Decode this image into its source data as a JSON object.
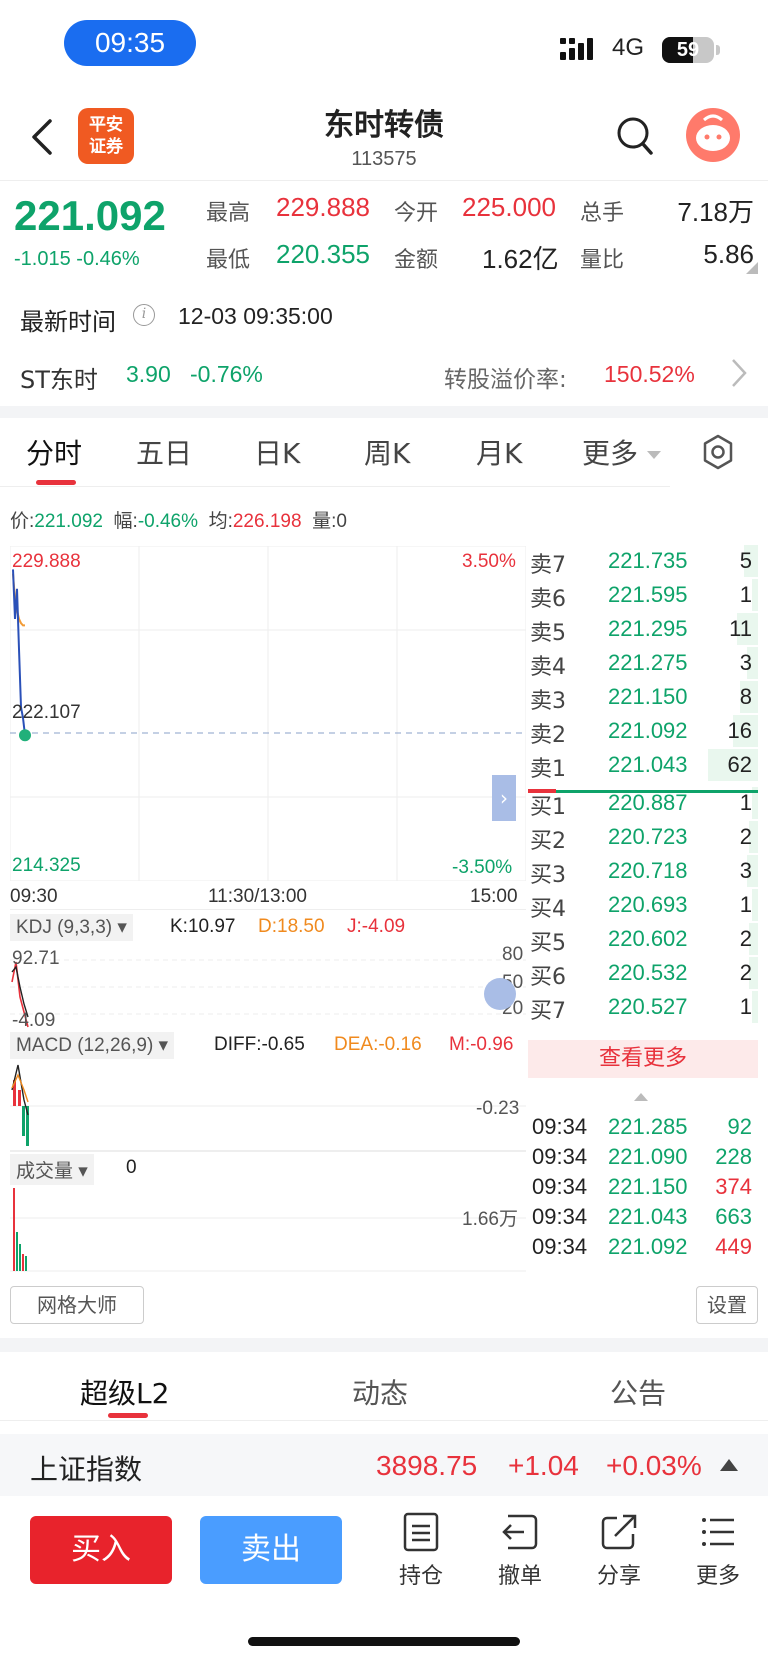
{
  "status_bar": {
    "time": "09:35",
    "network": "4G",
    "battery": "59"
  },
  "header": {
    "title": "东时转债",
    "code": "113575",
    "logo_line1": "平安",
    "logo_line2": "证券"
  },
  "quote": {
    "price": "221.092",
    "change": "-1.015",
    "change_pct": "-0.46%",
    "high_label": "最高",
    "high": "229.888",
    "open_label": "今开",
    "open": "225.000",
    "volume_label": "总手",
    "volume": "7.18万",
    "low_label": "最低",
    "low": "220.355",
    "amount_label": "金额",
    "amount": "1.62亿",
    "ratio_label": "量比",
    "ratio": "5.86",
    "latest_time_label": "最新时间",
    "latest_time": "12-03 09:35:00",
    "stock_name": "ST东时",
    "stock_price": "3.90",
    "stock_change": "-0.76%",
    "premium_label": "转股溢价率:",
    "premium": "150.52%"
  },
  "tabs": [
    "分时",
    "五日",
    "日K",
    "周K",
    "月K",
    "更多"
  ],
  "chart_info": {
    "price_label": "价:",
    "price": "221.092",
    "range_label": "幅:",
    "range": "-0.46%",
    "avg_label": "均:",
    "avg": "226.198",
    "vol_label": "量:",
    "vol": "0"
  },
  "chart_data": {
    "type": "line",
    "y_high": "229.888",
    "y_mid": "222.107",
    "y_low": "214.325",
    "pct_high": "3.50%",
    "pct_low": "-3.50%",
    "x_labels": [
      "09:30",
      "11:30/13:00",
      "15:00"
    ],
    "ylim": [
      214.325,
      229.888
    ],
    "series": [
      {
        "values": [
          228.8,
          226.5,
          227.9,
          225.1,
          222.4,
          221.9,
          221.092
        ]
      },
      {
        "values": [
          228.6,
          227.4,
          226.9,
          226.5,
          226.3,
          226.2,
          226.198
        ]
      }
    ]
  },
  "kdj": {
    "selector": "KDJ (9,3,3)",
    "k": "K:10.97",
    "d": "D:18.50",
    "j": "J:-4.09",
    "top": "92.71",
    "bottom": "-4.09",
    "l80": "80",
    "l50": "50",
    "l20": "20"
  },
  "macd": {
    "selector": "MACD (12,26,9)",
    "diff": "DIFF:-0.65",
    "dea": "DEA:-0.16",
    "m": "M:-0.96",
    "level": "-0.23"
  },
  "volume": {
    "selector": "成交量",
    "value": "0",
    "level": "1.66万"
  },
  "order_book": {
    "asks": [
      {
        "label": "卖7",
        "price": "221.735",
        "qty": "5"
      },
      {
        "label": "卖6",
        "price": "221.595",
        "qty": "1"
      },
      {
        "label": "卖5",
        "price": "221.295",
        "qty": "11"
      },
      {
        "label": "卖4",
        "price": "221.275",
        "qty": "3"
      },
      {
        "label": "卖3",
        "price": "221.150",
        "qty": "8"
      },
      {
        "label": "卖2",
        "price": "221.092",
        "qty": "16"
      },
      {
        "label": "卖1",
        "price": "221.043",
        "qty": "62"
      }
    ],
    "bids": [
      {
        "label": "买1",
        "price": "220.887",
        "qty": "1"
      },
      {
        "label": "买2",
        "price": "220.723",
        "qty": "2"
      },
      {
        "label": "买3",
        "price": "220.718",
        "qty": "3"
      },
      {
        "label": "买4",
        "price": "220.693",
        "qty": "1"
      },
      {
        "label": "买5",
        "price": "220.602",
        "qty": "2"
      },
      {
        "label": "买6",
        "price": "220.532",
        "qty": "2"
      },
      {
        "label": "买7",
        "price": "220.527",
        "qty": "1"
      }
    ],
    "more_label": "查看更多"
  },
  "trades": [
    {
      "time": "09:34",
      "price": "221.285",
      "qty": "92",
      "side": "green"
    },
    {
      "time": "09:34",
      "price": "221.090",
      "qty": "228",
      "side": "green"
    },
    {
      "time": "09:34",
      "price": "221.150",
      "qty": "374",
      "side": "red"
    },
    {
      "time": "09:34",
      "price": "221.043",
      "qty": "663",
      "side": "green"
    },
    {
      "time": "09:34",
      "price": "221.092",
      "qty": "449",
      "side": "red"
    }
  ],
  "tools": {
    "grid": "网格大师",
    "settings": "设置"
  },
  "bottom_tabs": [
    "超级L2",
    "动态",
    "公告"
  ],
  "index": {
    "name": "上证指数",
    "value": "3898.75",
    "change": "+1.04",
    "pct": "+0.03%"
  },
  "actions": {
    "buy": "买入",
    "sell": "卖出",
    "position": "持仓",
    "cancel": "撤单",
    "share": "分享",
    "more": "更多"
  },
  "colors": {
    "up": "#e8323c",
    "down": "#0ea36a",
    "accent": "#1a6df0"
  }
}
